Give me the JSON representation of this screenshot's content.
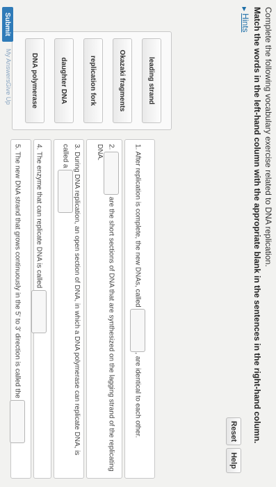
{
  "instructions": {
    "line1": "Complete the following vocabulary exercise related to DNA replication.",
    "line2": "Match the words in the left-hand column with the appropriate blank in the sentences in the right-hand column."
  },
  "hints": {
    "icon": "triangle-right-icon",
    "label": "Hints"
  },
  "toolbar": {
    "reset": "Reset",
    "help": "Help"
  },
  "word_bank": [
    "leading strand",
    "Okazaki fragments",
    "replication fork",
    "daughter DNA",
    "DNA polymerase"
  ],
  "sentences": {
    "s1": {
      "num": "1.",
      "before": "After replication is complete, the new DNAs, called",
      "after": ", are identical to each other."
    },
    "s2": {
      "num": "2.",
      "after": "are the short sections of DNA that are synthesized on the lagging strand of the replicating DNA."
    },
    "s3": {
      "text": "3. During DNA replication, an open section of DNA, in which a DNA polymerase can replicate DNA, is called a"
    },
    "s4": {
      "text": "4. The enzyme that can replicate DNA is called"
    },
    "s5": {
      "text": "5. The new DNA strand that grows continuously in the 5' to 3' direction is called the"
    }
  },
  "footer": {
    "submit": "Submit",
    "my_answers": "My Answers",
    "give_up": "Give Up"
  }
}
